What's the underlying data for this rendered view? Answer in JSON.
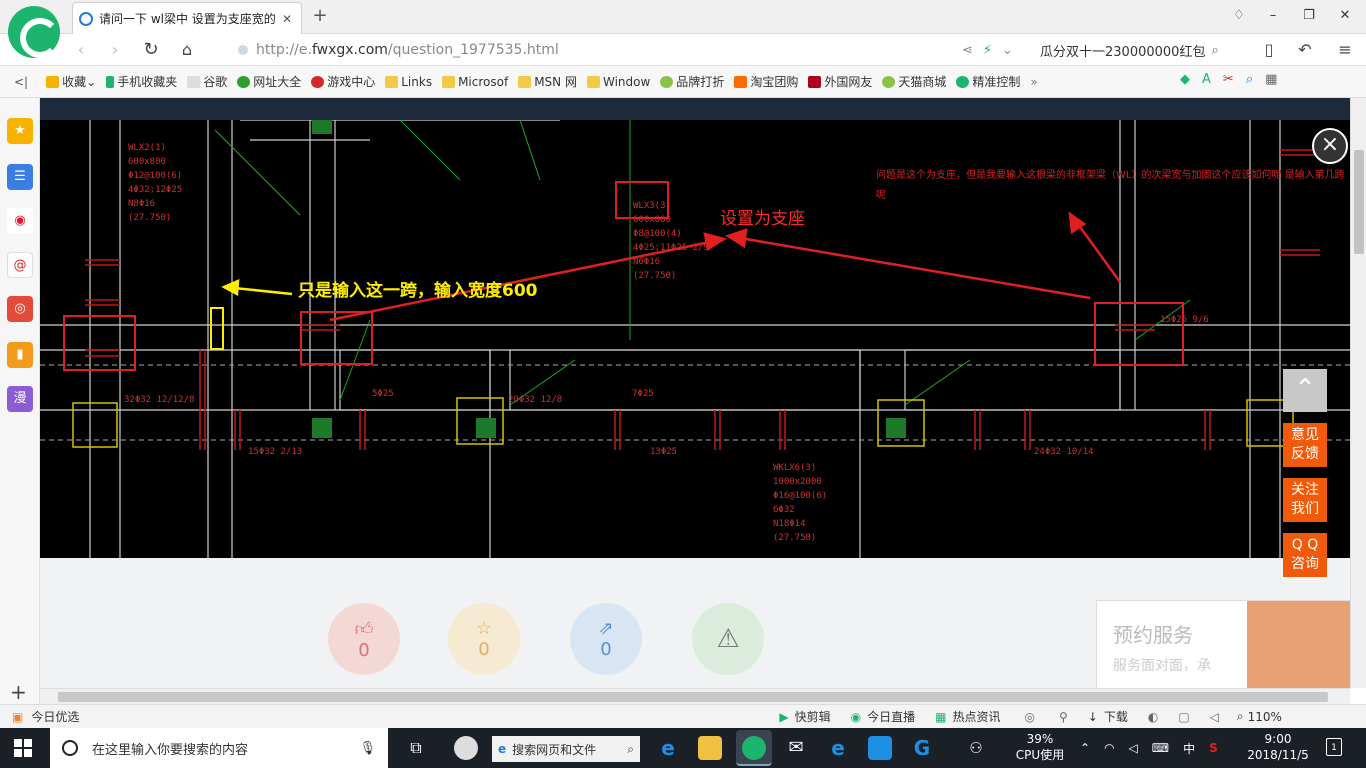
{
  "browser": {
    "tab_title": "请问一下 wl梁中 设置为支座宽的",
    "url_host_prefix": "http://e.",
    "url_host": "fwxgx.com",
    "url_path": "/question_1977535.html",
    "search_text": "瓜分双十一230000000红包",
    "icons": [
      "back-icon",
      "forward-icon",
      "reload-icon",
      "home-icon",
      "share-icon",
      "lightning-icon",
      "chevron-down-icon",
      "search-icon",
      "phone-icon",
      "undo-icon",
      "menu-icon"
    ]
  },
  "bookmarks": [
    {
      "label": "收藏",
      "icon": "star-icon"
    },
    {
      "label": "手机收藏夹",
      "icon": "phone-icon"
    },
    {
      "label": "谷歌",
      "icon": "page-icon"
    },
    {
      "label": "网址大全",
      "icon": "globe-icon"
    },
    {
      "label": "游戏中心",
      "icon": "game-icon"
    },
    {
      "label": "Links",
      "icon": "folder-icon"
    },
    {
      "label": "Microsof",
      "icon": "folder-icon"
    },
    {
      "label": "MSN 网",
      "icon": "folder-icon"
    },
    {
      "label": "Window",
      "icon": "folder-icon"
    },
    {
      "label": "品牌打折",
      "icon": "leaf-icon"
    },
    {
      "label": "淘宝团购",
      "icon": "taobao-icon"
    },
    {
      "label": "外国网友",
      "icon": "flag-icon"
    },
    {
      "label": "天猫商城",
      "icon": "leaf-icon"
    },
    {
      "label": "精准控制",
      "icon": "chat-icon"
    }
  ],
  "sidebar": [
    {
      "icon": "favorites-star-icon",
      "color": "#f6b400"
    },
    {
      "icon": "news-list-icon",
      "color": "#3b7de0"
    },
    {
      "icon": "weibo-icon",
      "color": "#e6162d"
    },
    {
      "icon": "mail-at-icon",
      "color": "#ffffff"
    },
    {
      "icon": "game-controller-icon",
      "color": "#e24a3a"
    },
    {
      "icon": "book-icon",
      "color": "#f29a1a"
    },
    {
      "icon": "comic-icon",
      "color": "#8a5cd6",
      "label": "漫"
    }
  ],
  "cad": {
    "annotation_support": "设置为支座",
    "annotation_span": "只是输入这一跨，输入宽度600",
    "annotation_question": "问题是这个为支座，但是我要输入这根梁的非框架梁（WL）的次梁宽与加固这个应该如何呢 是输入第几跨呢",
    "beam_labels": [
      "WLX2(1)",
      "600x800",
      "Φ12@100(6)",
      "4Φ32;12Φ25",
      "N8Φ16",
      "(27.750)",
      "WLX3(3)",
      "600x800",
      "Φ8@100(4)",
      "4Φ25;11Φ25 2/9",
      "N6Φ16",
      "(27.750)",
      "WKLX6(3)",
      "1000x2000",
      "Φ16@100(6)",
      "6Φ32",
      "N18Φ14",
      "(27.750)",
      "15Φ25 9/6",
      "5Φ25",
      "7Φ25",
      "13Φ25",
      "24Φ32 10/14",
      "20Φ32 12/8",
      "32Φ32 12/12/8",
      "15Φ32 2/13"
    ]
  },
  "overlay": {
    "close": "×",
    "feedback": [
      "意见",
      "反馈"
    ],
    "follow": [
      "关注",
      "我们"
    ],
    "qq": [
      "Q Q",
      "咨询"
    ]
  },
  "page_actions": {
    "like_count": "0",
    "fav_count": "0",
    "share_count": "0",
    "service_title": "预约服务",
    "service_sub": "服务面对面，承"
  },
  "statusbar": {
    "left": "今日优选",
    "items": [
      "快剪辑",
      "今日直播",
      "热点资讯",
      "下载"
    ],
    "zoom": "110%"
  },
  "taskbar": {
    "search_placeholder": "在这里输入你要搜索的内容",
    "web_search": "搜索网页和文件",
    "cpu_percent": "39%",
    "cpu_label": "CPU使用",
    "ime": "中",
    "time": "9:00",
    "date": "2018/11/5",
    "notifications": "1"
  },
  "colors": {
    "accent": "#1db46e",
    "cad_background": "#000000",
    "annotation_red": "#e02020",
    "annotation_yellow": "#ffee00",
    "overlay_orange": "#f05a0a"
  }
}
